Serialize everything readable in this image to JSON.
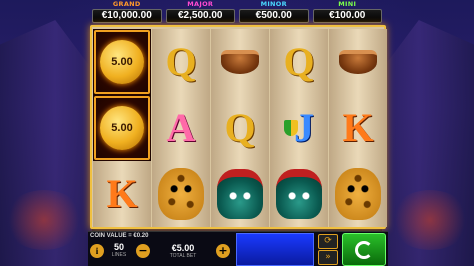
{
  "jackpots": [
    {
      "label": "GRAND",
      "value": "€10,000.00"
    },
    {
      "label": "MAJOR",
      "value": "€2,500.00"
    },
    {
      "label": "MINOR",
      "value": "€500.00"
    },
    {
      "label": "MINI",
      "value": "€100.00"
    }
  ],
  "reels": {
    "r1": {
      "c1": "5.00",
      "c2": "5.00",
      "c3": "K"
    },
    "r2": {
      "c1": "Q",
      "c2": "A",
      "c3": "jaguar"
    },
    "r3": {
      "c1": "bowl",
      "c2": "Q",
      "c3": "mask"
    },
    "r4": {
      "c1": "Q",
      "c2": "J",
      "c3": "mask"
    },
    "r5": {
      "c1": "bowl",
      "c2": "K",
      "c3": "jaguar"
    }
  },
  "bottom": {
    "coin_value": "COIN VALUE = €0.20",
    "lines_value": "50",
    "lines_label": "LINES",
    "total_bet_value": "€5.00",
    "total_bet_label": "TOTAL BET"
  }
}
